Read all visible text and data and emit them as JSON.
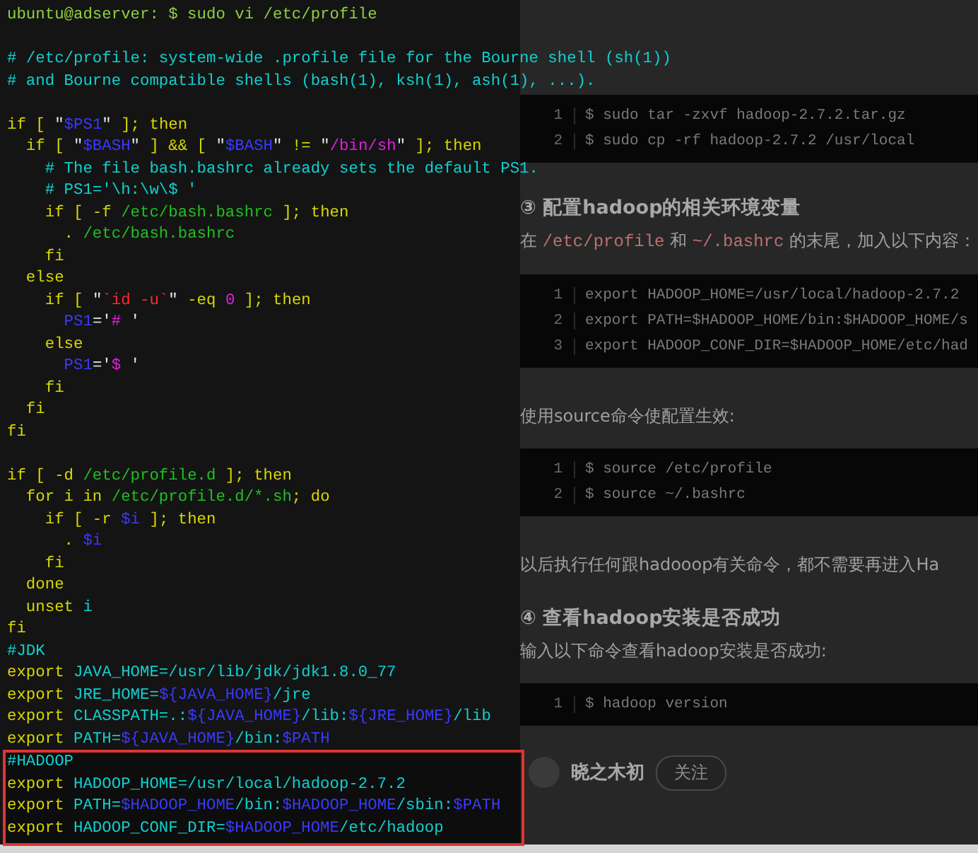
{
  "terminal": {
    "lines": [
      {
        "gap_before": false,
        "segments": [
          {
            "text": "ubuntu@adserver: $ sudo vi /etc/profile",
            "kind": "prompt"
          }
        ]
      },
      {
        "gap_before": true,
        "segments": [
          {
            "text": "# /etc/profile: system-wide .profile file for the Bourne shell (sh(1))",
            "kind": "comment"
          }
        ]
      },
      {
        "gap_before": false,
        "segments": [
          {
            "text": "# and Bourne compatible shells (bash(1), ksh(1), ash(1), ...).",
            "kind": "comment"
          }
        ]
      },
      {
        "gap_before": true,
        "segments": [
          {
            "text": "if [ ",
            "kind": "keyword"
          },
          {
            "text": "\"",
            "kind": "plain"
          },
          {
            "text": "$PS1",
            "kind": "var"
          },
          {
            "text": "\"",
            "kind": "plain"
          },
          {
            "text": " ]; then",
            "kind": "keyword"
          }
        ]
      },
      {
        "gap_before": false,
        "segments": [
          {
            "text": "  if [ ",
            "kind": "keyword"
          },
          {
            "text": "\"",
            "kind": "plain"
          },
          {
            "text": "$BASH",
            "kind": "var"
          },
          {
            "text": "\"",
            "kind": "plain"
          },
          {
            "text": " ] && [ ",
            "kind": "keyword"
          },
          {
            "text": "\"",
            "kind": "plain"
          },
          {
            "text": "$BASH",
            "kind": "var"
          },
          {
            "text": "\"",
            "kind": "plain"
          },
          {
            "text": " != ",
            "kind": "keyword"
          },
          {
            "text": "\"",
            "kind": "plain"
          },
          {
            "text": "/bin/sh",
            "kind": "string"
          },
          {
            "text": "\"",
            "kind": "plain"
          },
          {
            "text": " ]; then",
            "kind": "keyword"
          }
        ]
      },
      {
        "gap_before": false,
        "segments": [
          {
            "text": "    # The file bash.bashrc already sets the default PS1.",
            "kind": "comment"
          }
        ]
      },
      {
        "gap_before": false,
        "segments": [
          {
            "text": "    # PS1='\\h:\\w\\$ '",
            "kind": "comment"
          }
        ]
      },
      {
        "gap_before": false,
        "segments": [
          {
            "text": "    if [ -f ",
            "kind": "keyword"
          },
          {
            "text": "/etc/bash.bashrc",
            "kind": "path"
          },
          {
            "text": " ]; then",
            "kind": "keyword"
          }
        ]
      },
      {
        "gap_before": false,
        "segments": [
          {
            "text": "      . ",
            "kind": "keyword"
          },
          {
            "text": "/etc/bash.bashrc",
            "kind": "path"
          }
        ]
      },
      {
        "gap_before": false,
        "segments": [
          {
            "text": "    fi",
            "kind": "keyword"
          }
        ]
      },
      {
        "gap_before": false,
        "segments": [
          {
            "text": "  else",
            "kind": "keyword"
          }
        ]
      },
      {
        "gap_before": false,
        "segments": [
          {
            "text": "    if [ ",
            "kind": "keyword"
          },
          {
            "text": "\"",
            "kind": "plain"
          },
          {
            "text": "`id -u`",
            "kind": "error"
          },
          {
            "text": "\"",
            "kind": "plain"
          },
          {
            "text": " -eq ",
            "kind": "keyword"
          },
          {
            "text": "0",
            "kind": "string"
          },
          {
            "text": " ]; then",
            "kind": "keyword"
          }
        ]
      },
      {
        "gap_before": false,
        "segments": [
          {
            "text": "      PS1",
            "kind": "var"
          },
          {
            "text": "='",
            "kind": "plain"
          },
          {
            "text": "#",
            "kind": "string"
          },
          {
            "text": " '",
            "kind": "plain"
          }
        ]
      },
      {
        "gap_before": false,
        "segments": [
          {
            "text": "    else",
            "kind": "keyword"
          }
        ]
      },
      {
        "gap_before": false,
        "segments": [
          {
            "text": "      PS1",
            "kind": "var"
          },
          {
            "text": "='",
            "kind": "plain"
          },
          {
            "text": "$",
            "kind": "string"
          },
          {
            "text": " '",
            "kind": "plain"
          }
        ]
      },
      {
        "gap_before": false,
        "segments": [
          {
            "text": "    fi",
            "kind": "keyword"
          }
        ]
      },
      {
        "gap_before": false,
        "segments": [
          {
            "text": "  fi",
            "kind": "keyword"
          }
        ]
      },
      {
        "gap_before": false,
        "segments": [
          {
            "text": "fi",
            "kind": "keyword"
          }
        ]
      },
      {
        "gap_before": true,
        "segments": [
          {
            "text": "if [ -d ",
            "kind": "keyword"
          },
          {
            "text": "/etc/profile.d",
            "kind": "path"
          },
          {
            "text": " ]; then",
            "kind": "keyword"
          }
        ]
      },
      {
        "gap_before": false,
        "segments": [
          {
            "text": "  for i in ",
            "kind": "keyword"
          },
          {
            "text": "/etc/profile.d/*.sh",
            "kind": "path"
          },
          {
            "text": "; do",
            "kind": "keyword"
          }
        ]
      },
      {
        "gap_before": false,
        "segments": [
          {
            "text": "    if [ -r ",
            "kind": "keyword"
          },
          {
            "text": "$i",
            "kind": "var"
          },
          {
            "text": " ]; then",
            "kind": "keyword"
          }
        ]
      },
      {
        "gap_before": false,
        "segments": [
          {
            "text": "      . ",
            "kind": "keyword"
          },
          {
            "text": "$i",
            "kind": "var"
          }
        ]
      },
      {
        "gap_before": false,
        "segments": [
          {
            "text": "    fi",
            "kind": "keyword"
          }
        ]
      },
      {
        "gap_before": false,
        "segments": [
          {
            "text": "  done",
            "kind": "keyword"
          }
        ]
      },
      {
        "gap_before": false,
        "segments": [
          {
            "text": "  unset ",
            "kind": "keyword"
          },
          {
            "text": "i",
            "kind": "ident"
          }
        ]
      },
      {
        "gap_before": false,
        "segments": [
          {
            "text": "fi",
            "kind": "keyword"
          }
        ]
      },
      {
        "gap_before": false,
        "segments": [
          {
            "text": "#JDK",
            "kind": "comment"
          }
        ]
      },
      {
        "gap_before": false,
        "segments": [
          {
            "text": "export ",
            "kind": "keyword"
          },
          {
            "text": "JAVA_HOME=/usr/lib/jdk/jdk1.8.0_77",
            "kind": "ident"
          }
        ]
      },
      {
        "gap_before": false,
        "segments": [
          {
            "text": "export ",
            "kind": "keyword"
          },
          {
            "text": "JRE_HOME=",
            "kind": "ident"
          },
          {
            "text": "${JAVA_HOME}",
            "kind": "var"
          },
          {
            "text": "/jre",
            "kind": "ident"
          }
        ]
      },
      {
        "gap_before": false,
        "segments": [
          {
            "text": "export ",
            "kind": "keyword"
          },
          {
            "text": "CLASSPATH=.:",
            "kind": "ident"
          },
          {
            "text": "${JAVA_HOME}",
            "kind": "var"
          },
          {
            "text": "/lib:",
            "kind": "ident"
          },
          {
            "text": "${JRE_HOME}",
            "kind": "var"
          },
          {
            "text": "/lib",
            "kind": "ident"
          }
        ]
      },
      {
        "gap_before": false,
        "segments": [
          {
            "text": "export ",
            "kind": "keyword"
          },
          {
            "text": "PATH=",
            "kind": "ident"
          },
          {
            "text": "${JAVA_HOME}",
            "kind": "var"
          },
          {
            "text": "/bin:",
            "kind": "ident"
          },
          {
            "text": "$PATH",
            "kind": "var"
          }
        ]
      }
    ],
    "highlighted_lines": [
      {
        "gap_before": false,
        "segments": [
          {
            "text": "#HADOOP",
            "kind": "comment"
          }
        ]
      },
      {
        "gap_before": false,
        "segments": [
          {
            "text": "export ",
            "kind": "keyword"
          },
          {
            "text": "HADOOP_HOME=/usr/local/hadoop-2.7.2",
            "kind": "ident"
          }
        ]
      },
      {
        "gap_before": false,
        "segments": [
          {
            "text": "export ",
            "kind": "keyword"
          },
          {
            "text": "PATH=",
            "kind": "ident"
          },
          {
            "text": "$HADOOP_HOME",
            "kind": "var"
          },
          {
            "text": "/bin:",
            "kind": "ident"
          },
          {
            "text": "$HADOOP_HOME",
            "kind": "var"
          },
          {
            "text": "/sbin:",
            "kind": "ident"
          },
          {
            "text": "$PATH",
            "kind": "var"
          }
        ]
      },
      {
        "gap_before": false,
        "segments": [
          {
            "text": "export ",
            "kind": "keyword"
          },
          {
            "text": "HADOOP_CONF_DIR=",
            "kind": "ident"
          },
          {
            "text": "$HADOOP_HOME",
            "kind": "var"
          },
          {
            "text": "/etc/hadoop",
            "kind": "ident"
          }
        ]
      }
    ]
  },
  "article": {
    "blocks": [
      {
        "kind": "code",
        "lines": [
          {
            "number": "1",
            "code": "$ sudo tar -zxvf hadoop-2.7.2.tar.gz"
          },
          {
            "number": "2",
            "code": "$ sudo cp -rf hadoop-2.7.2 /usr/local"
          }
        ]
      },
      {
        "kind": "heading",
        "text": "③ 配置hadoop的相关环境变量"
      },
      {
        "kind": "paragraph",
        "parts": [
          {
            "text": "在 ",
            "code": false
          },
          {
            "text": "/etc/profile",
            "code": true
          },
          {
            "text": " 和 ",
            "code": false
          },
          {
            "text": "~/.bashrc",
            "code": true
          },
          {
            "text": " 的末尾，加入以下内容：",
            "code": false
          }
        ]
      },
      {
        "kind": "code",
        "lines": [
          {
            "number": "1",
            "code": "export HADOOP_HOME=/usr/local/hadoop-2.7.2"
          },
          {
            "number": "2",
            "code": "export PATH=$HADOOP_HOME/bin:$HADOOP_HOME/s"
          },
          {
            "number": "3",
            "code": "export HADOOP_CONF_DIR=$HADOOP_HOME/etc/had"
          }
        ]
      },
      {
        "kind": "paragraph",
        "parts": [
          {
            "text": "使用source命令使配置生效:",
            "code": false
          }
        ]
      },
      {
        "kind": "code",
        "lines": [
          {
            "number": "1",
            "code": "$ source /etc/profile"
          },
          {
            "number": "2",
            "code": "$ source ~/.bashrc"
          }
        ]
      },
      {
        "kind": "paragraph",
        "parts": [
          {
            "text": "以后执行任何跟hadooop有关命令，都不需要再进入Ha",
            "code": false
          }
        ]
      },
      {
        "kind": "heading",
        "text": "④ 查看hadoop安装是否成功"
      },
      {
        "kind": "paragraph",
        "parts": [
          {
            "text": "输入以下命令查看hadoop安装是否成功:",
            "code": false
          }
        ]
      },
      {
        "kind": "code",
        "lines": [
          {
            "number": "1",
            "code": "$ hadoop version"
          }
        ]
      }
    ],
    "author": {
      "name": "晓之木初",
      "follow_button": "关注"
    }
  }
}
